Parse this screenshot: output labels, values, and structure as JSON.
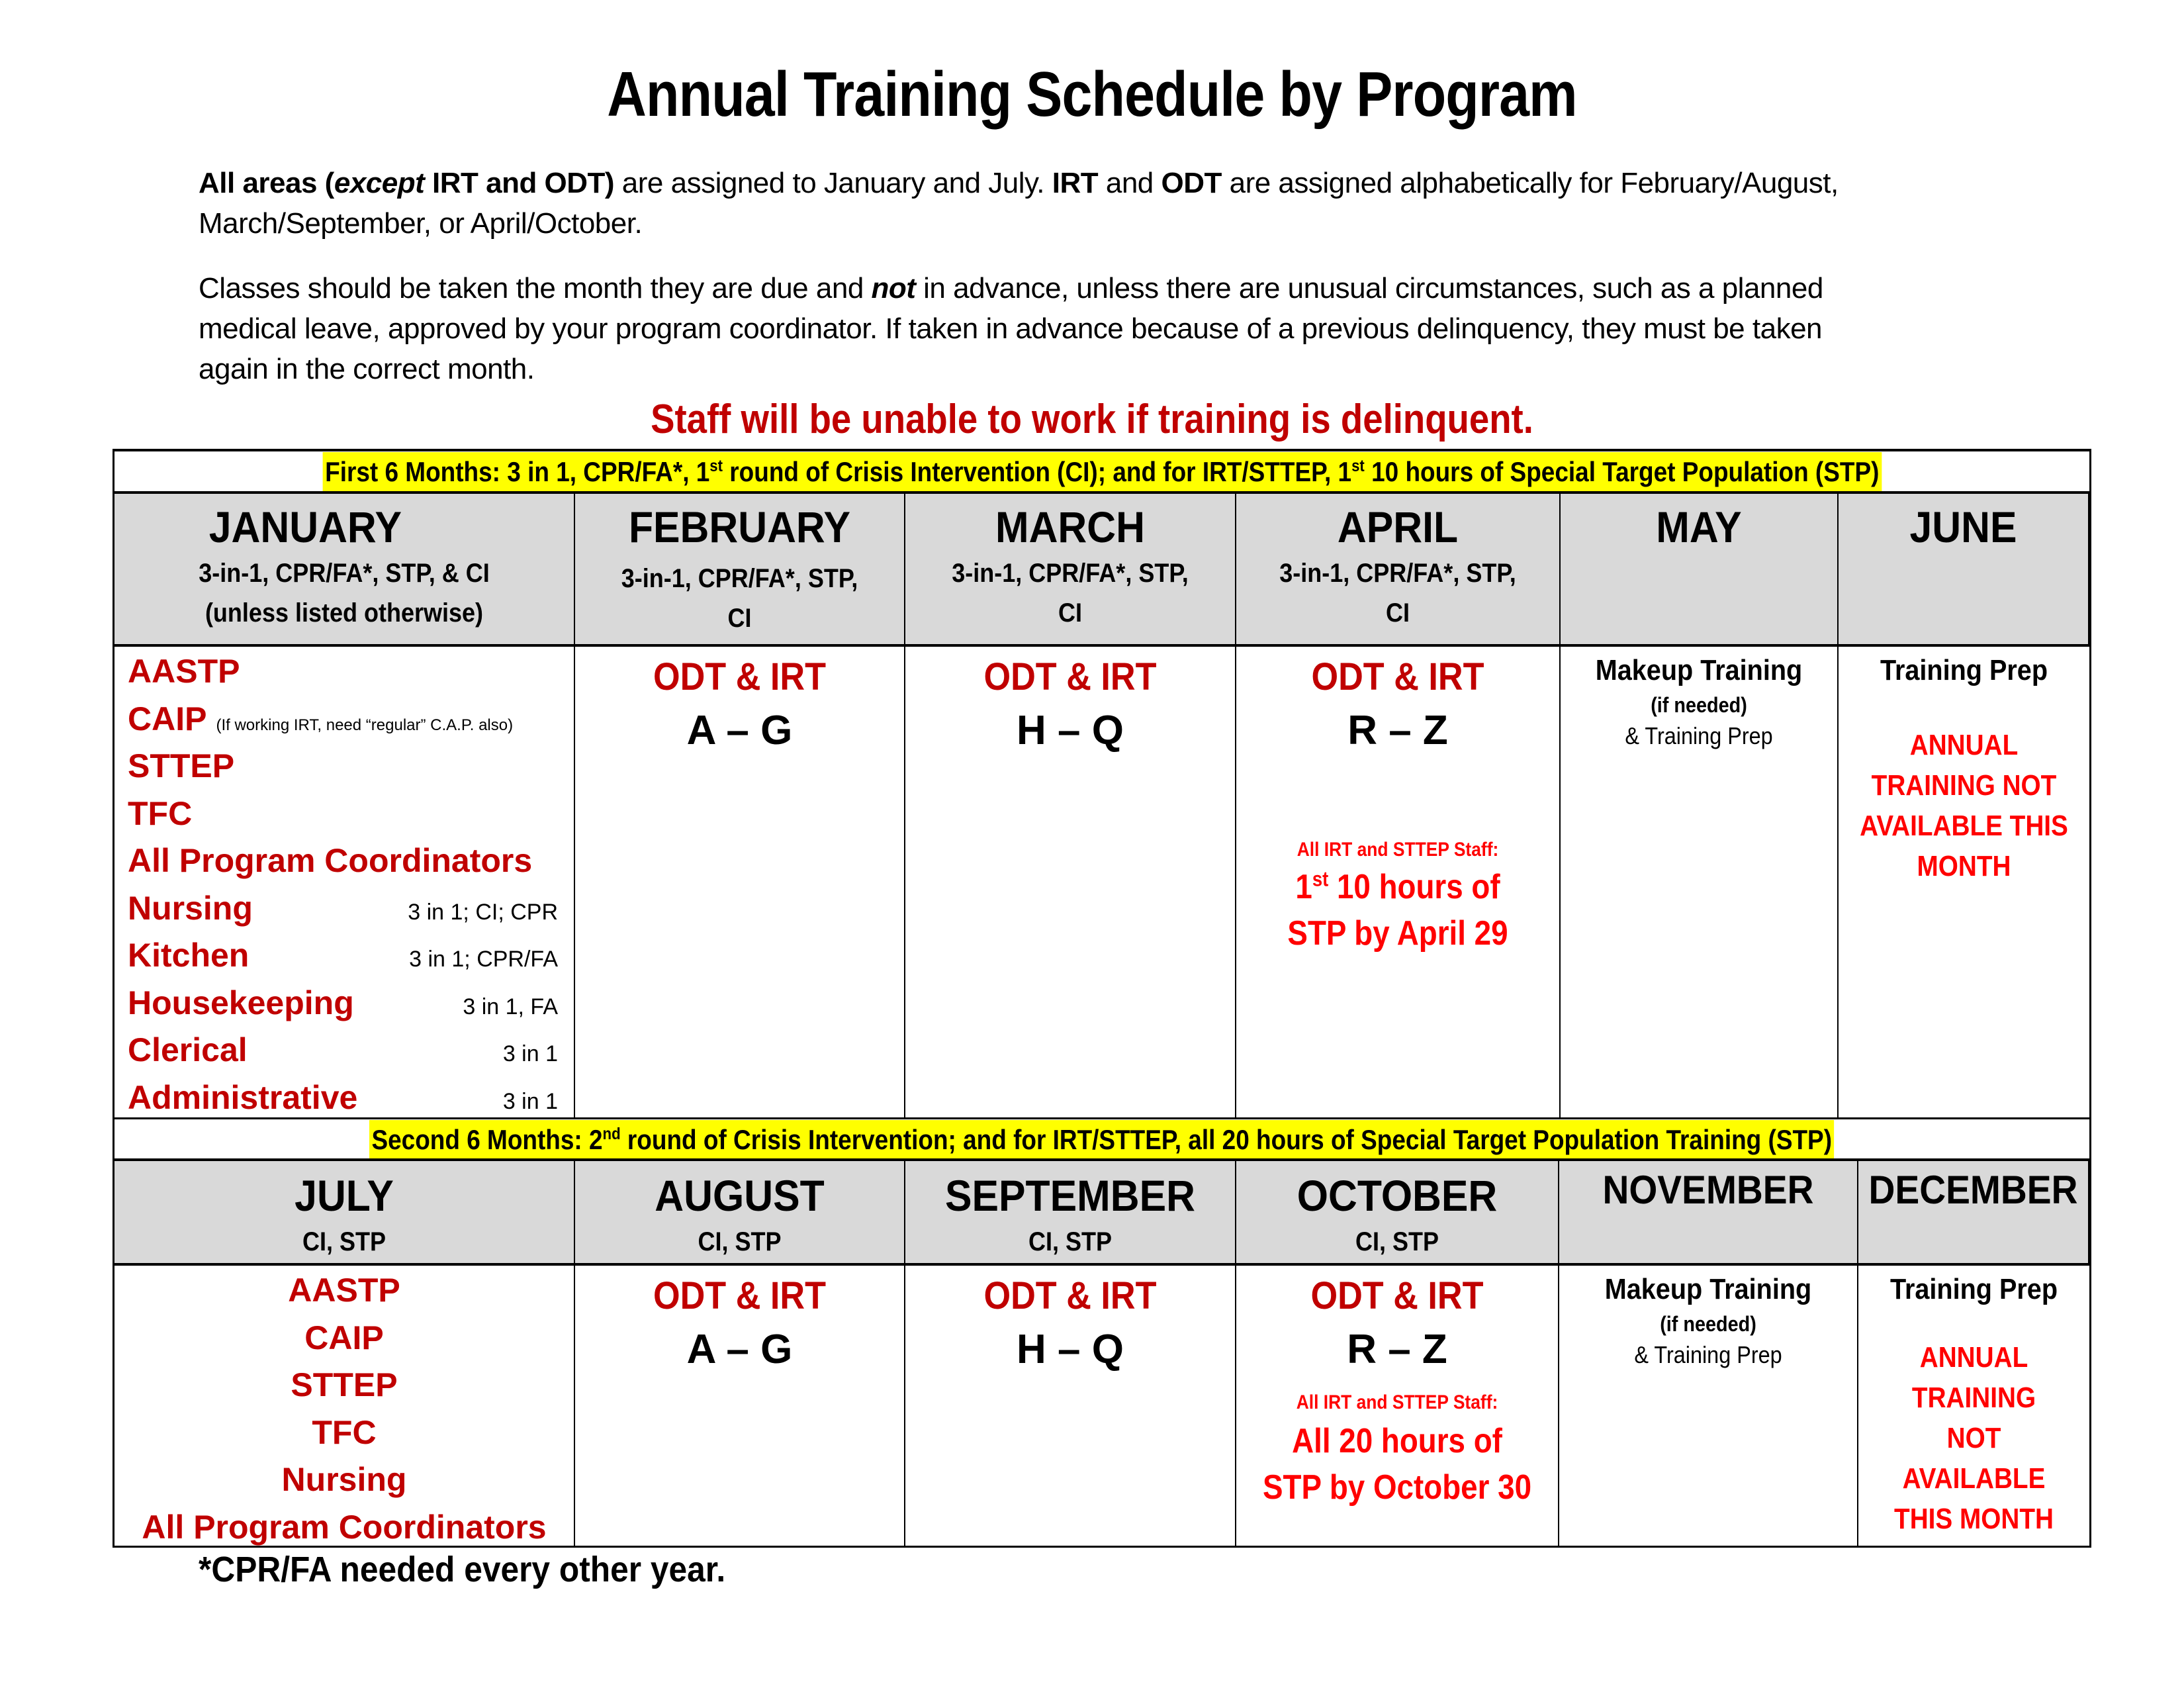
{
  "title": "Annual Training Schedule by Program",
  "intro": {
    "p1_bold": "All areas (",
    "p1_italic": "except",
    "p1_bold2": " IRT and ODT)",
    "p1_text": " are assigned to January and July. ",
    "p1_irt": "IRT",
    "p1_and": " and ",
    "p1_odt": "ODT",
    "p1_rest": " are assigned alphabetically for February/August,",
    "p1_line2": "March/September, or April/October.",
    "p2_a": "Classes should be taken the month they are due and ",
    "p2_not": "not",
    "p2_b": " in advance, unless there are unusual circumstances, such as a planned",
    "p2_line2": "medical leave, approved by your program coordinator. If taken in advance because of a previous delinquency, they must be taken",
    "p2_line3": "again in the correct month."
  },
  "warning": "Staff will be unable to work if training is delinquent.",
  "first_half": {
    "band": {
      "a": "First 6 Months: 3 in 1, CPR/FA*, 1",
      "sup1": "st",
      "b": " round of Crisis Intervention (CI); and for IRT/STTEP, 1",
      "sup2": "st",
      "c": " 10 hours of Special Target Population (STP)"
    },
    "months": [
      {
        "name": "JANUARY",
        "sub1": "3-in-1, CPR/FA*, STP, & CI",
        "sub2": "(unless listed otherwise)"
      },
      {
        "name": "FEBRUARY",
        "sub1": "3-in-1, CPR/FA*, STP,",
        "sub2": "CI"
      },
      {
        "name": "MARCH",
        "sub1": "3-in-1, CPR/FA*, STP,",
        "sub2": "CI"
      },
      {
        "name": "APRIL",
        "sub1": "3-in-1, CPR/FA*, STP,",
        "sub2": "CI"
      },
      {
        "name": "MAY",
        "sub1": "",
        "sub2": ""
      },
      {
        "name": "JUNE",
        "sub1": "",
        "sub2": ""
      }
    ],
    "programs": [
      {
        "name": "AASTP",
        "note": ""
      },
      {
        "name": "CAIP",
        "caip_note": "(If working IRT, need “regular” C.A.P. also)"
      },
      {
        "name": "STTEP",
        "note": ""
      },
      {
        "name": "TFC",
        "note": ""
      },
      {
        "name": "All Program Coordinators",
        "note": ""
      },
      {
        "name": "Nursing",
        "note": "3 in 1; CI; CPR"
      },
      {
        "name": "Kitchen",
        "note": "3 in 1; CPR/FA"
      },
      {
        "name": "Housekeeping",
        "note": "3 in 1, FA"
      },
      {
        "name": "Clerical",
        "note": "3 in 1"
      },
      {
        "name": "Administrative",
        "note": "3 in 1"
      }
    ],
    "feb": {
      "group": "ODT & IRT",
      "range": "A – G"
    },
    "mar": {
      "group": "ODT & IRT",
      "range": "H – Q"
    },
    "apr": {
      "group": "ODT & IRT",
      "range": "R – Z",
      "staff_label": "All IRT and STTEP Staff:",
      "line1_num": "1",
      "line1_sup": "st",
      "line1_rest": " 10 hours of",
      "line2": "STP by April 29"
    },
    "may": {
      "title": "Makeup Training",
      "sub": "(if needed)",
      "note": "& Training Prep"
    },
    "jun": {
      "title": "Training Prep",
      "na": [
        "ANNUAL",
        "TRAINING NOT",
        "AVAILABLE THIS",
        "MONTH"
      ]
    }
  },
  "second_half": {
    "band": {
      "a": "Second 6 Months: 2",
      "sup1": "nd",
      "b": " round of Crisis Intervention; and for IRT/STTEP, all 20 hours of Special Target Population Training (STP)"
    },
    "months": [
      {
        "name": "JULY",
        "sub1": "CI, STP"
      },
      {
        "name": "AUGUST",
        "sub1": "CI, STP"
      },
      {
        "name": "SEPTEMBER",
        "sub1": "CI, STP"
      },
      {
        "name": "OCTOBER",
        "sub1": "CI, STP"
      },
      {
        "name": "NOVEMBER",
        "sub1": ""
      },
      {
        "name": "DECEMBER",
        "sub1": ""
      }
    ],
    "programs": [
      "AASTP",
      "CAIP",
      "STTEP",
      "TFC",
      "Nursing",
      "All Program Coordinators"
    ],
    "aug": {
      "group": "ODT & IRT",
      "range": "A – G"
    },
    "sep": {
      "group": "ODT & IRT",
      "range": "H – Q"
    },
    "oct": {
      "group": "ODT & IRT",
      "range": "R – Z",
      "staff_label": "All IRT and STTEP Staff:",
      "line1": "All 20 hours of",
      "line2": "STP by October 30"
    },
    "nov": {
      "title": "Makeup Training",
      "sub": "(if needed)",
      "note": "& Training Prep"
    },
    "dec": {
      "title": "Training Prep",
      "na": [
        "ANNUAL",
        "TRAINING",
        "NOT",
        "AVAILABLE",
        "THIS MONTH"
      ]
    }
  },
  "footnote": "*CPR/FA needed every other year.",
  "colors": {
    "dark_red": "#c00000",
    "bright_red": "#ff0000",
    "highlight": "#ffff00",
    "header_gray": "#d9d9d9"
  }
}
